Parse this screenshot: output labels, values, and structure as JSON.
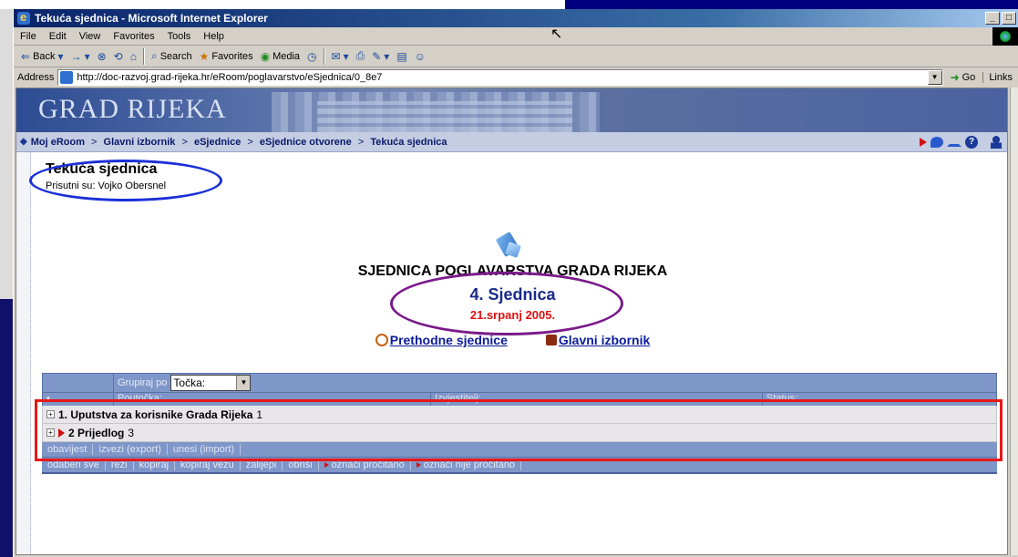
{
  "window": {
    "title": "Tekuća sjednica - Microsoft Internet Explorer",
    "buttons": {
      "minimize": "_",
      "restore": "□",
      "close": "x"
    }
  },
  "menu": [
    "File",
    "Edit",
    "View",
    "Favorites",
    "Tools",
    "Help"
  ],
  "toolbar": {
    "back": "Back",
    "search": "Search",
    "favorites": "Favorites",
    "media": "Media"
  },
  "address": {
    "label": "Address",
    "url": "http://doc-razvoj.grad-rijeka.hr/eRoom/poglavarstvo/eSjednica/0_8e7",
    "go": "Go",
    "links": "Links"
  },
  "banner": {
    "title": "GRAD RIJEKA"
  },
  "breadcrumb": [
    "Moj eRoom",
    "Glavni izbornik",
    "eSjednice",
    "eSjednice otvorene",
    "Tekuća sjednica"
  ],
  "breadcrumb_separator": ">",
  "page": {
    "heading": "Tekuća sjednica",
    "present": "Prisutni su: Vojko Obersnel"
  },
  "meeting": {
    "title": "SJEDNICA POGLAVARSTVA GRADA RIJEKA",
    "number": "4. Sjednica",
    "date": "21.srpanj 2005."
  },
  "navlinks": {
    "previous": "Prethodne sjednice",
    "main_menu": "Glavni izbornik"
  },
  "grid": {
    "group_label": "Grupiraj po",
    "group_value": "Točka:",
    "columns": [
      "Poutočka:",
      "Izvjestitelj:",
      "Status:"
    ],
    "rows": [
      {
        "label": "1. Uputstva za korisnike Grada Rijeka",
        "count": "1"
      },
      {
        "label": "2 Prijedlog",
        "count": "3"
      }
    ],
    "actions_row1": [
      "obavijest",
      "izvezi (export)",
      "unesi (import)"
    ],
    "actions_row2": [
      "odaberi sve",
      "reži",
      "kopiraj",
      "kopiraj vezu",
      "zalijepi",
      "obriši",
      "označi pročitano",
      "označi nije pročitano"
    ]
  }
}
